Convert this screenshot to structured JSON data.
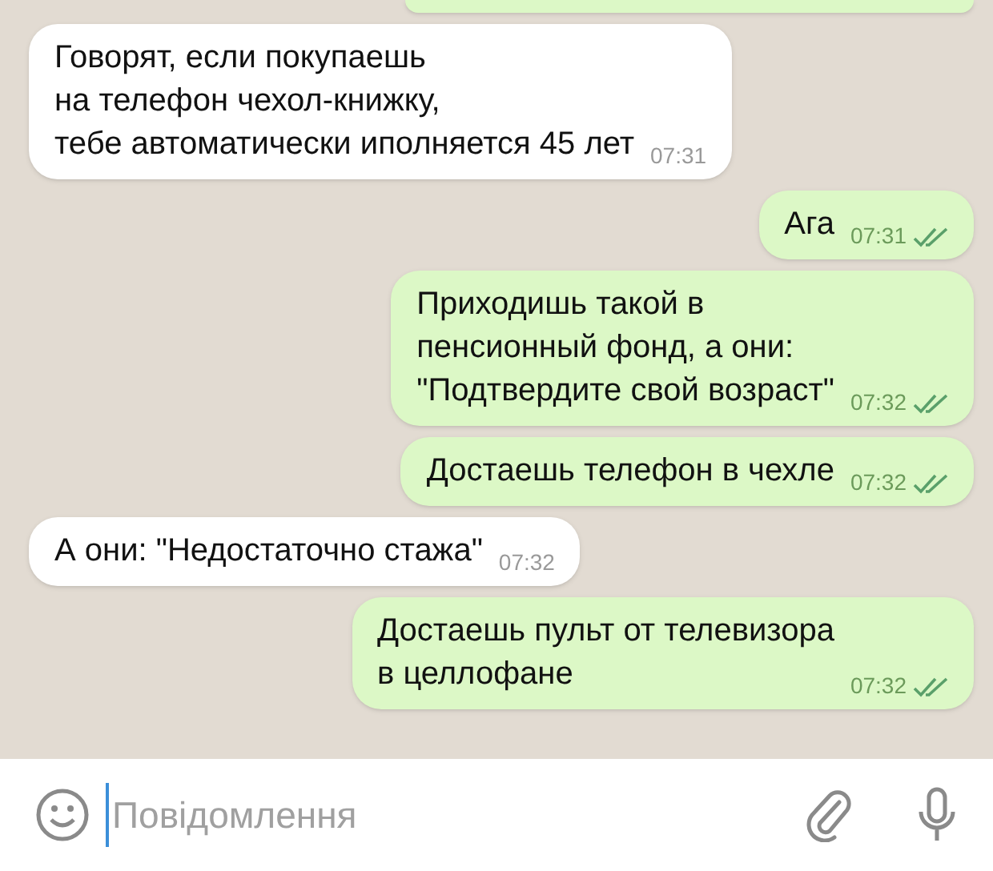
{
  "messages": [
    {
      "kind": "partial"
    },
    {
      "kind": "incoming",
      "text": "Говорят, если покупаешь\nна телефон чехол-книжку,\nтебе автоматически иполняется 45 лет",
      "time": "07:31"
    },
    {
      "kind": "outgoing",
      "text": "Ага",
      "time": "07:31",
      "read": true
    },
    {
      "kind": "outgoing",
      "text": "Приходишь такой в\nпенсионный фонд, а они:\n\"Подтвердите свой возраст\"",
      "time": "07:32",
      "read": true
    },
    {
      "kind": "outgoing",
      "text": "Достаешь телефон в чехле",
      "time": "07:32",
      "read": true
    },
    {
      "kind": "incoming",
      "text": "А они: \"Недостаточно стажа\"",
      "time": "07:32"
    },
    {
      "kind": "outgoing",
      "text": "Достаешь пульт от телевизора\nв целлофане",
      "time": "07:32",
      "read": true
    }
  ],
  "composer": {
    "placeholder": "Повідомлення"
  }
}
